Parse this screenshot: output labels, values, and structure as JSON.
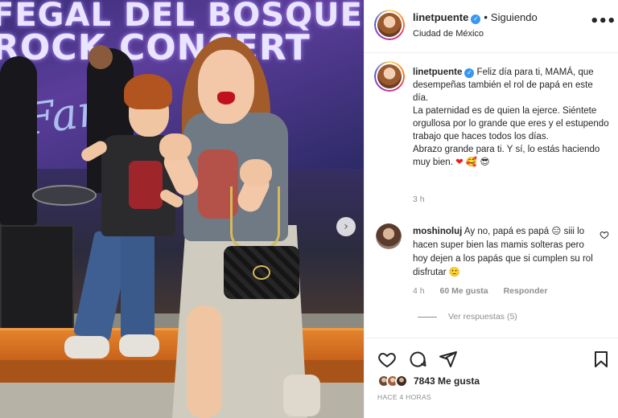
{
  "photo": {
    "banner_line_1": "FEGAL DEL BOSQUE",
    "banner_line_2": "ROCK CONCERT",
    "banner_script": "Fam",
    "next_icon": "chevron-right-icon"
  },
  "header": {
    "username": "linetpuente",
    "verified_mark": "✓",
    "separator": "•",
    "follow_status": "Siguiendo",
    "location": "Ciudad de México",
    "more_icon": "more-horizontal-icon",
    "more_glyph": "•••"
  },
  "caption": {
    "username": "linetpuente",
    "lines": [
      "Feliz día para ti, MAMÁ, que desempeñas también el rol de papá en este día.",
      "La paternidad es de quien la ejerce. Siéntete orgullosa por lo grande que eres y el estupendo trabajo que haces todos los días.",
      "Abrazo grande para ti. Y sí, lo estás haciendo muy bien."
    ],
    "emojis": [
      "❤",
      "🥰",
      "😎"
    ],
    "time": "3 h"
  },
  "comment": {
    "username": "moshinoluj",
    "text": "Ay no, papá es papá 😑 siii lo hacen super bien las mamis solteras pero hoy dejen a los papás que si cumplen su rol disfrutar 🙂",
    "time": "4 h",
    "likes": "60 Me gusta",
    "reply": "Responder",
    "view_replies": "Ver respuestas (5)",
    "like_icon": "heart-outline-icon"
  },
  "actions": {
    "icons": [
      "heart-outline-icon",
      "comment-icon",
      "share-icon",
      "bookmark-icon"
    ],
    "likes": "7843 Me gusta",
    "time_ago": "HACE 4 HORAS"
  },
  "colors": {
    "accent": "#3897f0",
    "text": "#262626",
    "secondary": "#8e8e8e"
  }
}
